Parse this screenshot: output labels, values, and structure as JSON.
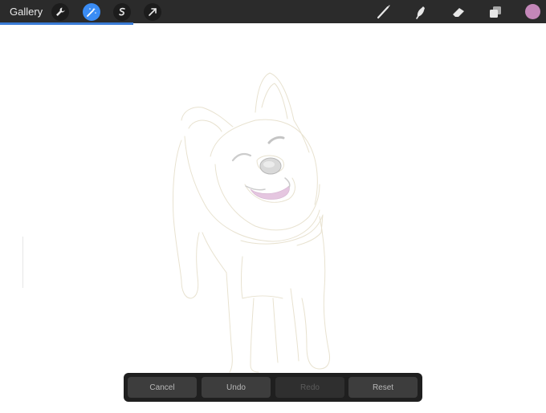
{
  "topbar": {
    "gallery_label": "Gallery",
    "left_tools": [
      {
        "name": "wrench-icon",
        "label": "Actions"
      },
      {
        "name": "magic-wand-icon",
        "label": "Adjustments",
        "active": true
      },
      {
        "name": "selection-icon",
        "label": "Selection"
      },
      {
        "name": "transform-arrow-icon",
        "label": "Transform"
      }
    ],
    "right_tools": [
      {
        "name": "brush-icon",
        "label": "Brush"
      },
      {
        "name": "smudge-icon",
        "label": "Smudge"
      },
      {
        "name": "eraser-icon",
        "label": "Eraser"
      },
      {
        "name": "layers-icon",
        "label": "Layers"
      }
    ],
    "current_color": "#c487b9",
    "accent_color": "#3a8cf5",
    "progress_fraction": 0.244
  },
  "action_bar": {
    "cancel_label": "Cancel",
    "undo_label": "Undo",
    "redo_label": "Redo",
    "reset_label": "Reset"
  },
  "canvas": {
    "subject": "dog-sketch",
    "line_color": "#e8e2d0",
    "tongue_color": "#e5c6e0"
  }
}
